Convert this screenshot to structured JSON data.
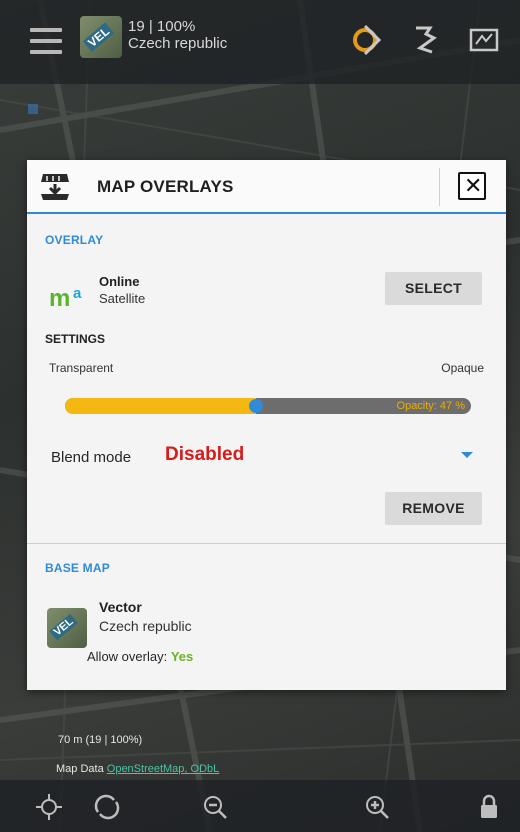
{
  "topbar": {
    "zoom_status": "19 | 100%",
    "region": "Czech republic",
    "icons": [
      "menu-icon",
      "map-icon",
      "gps-icon",
      "route-icon",
      "map-manager-icon"
    ]
  },
  "dialog": {
    "title": "MAP OVERLAYS",
    "overlay": {
      "section_label": "OVERLAY",
      "name": "Online",
      "type": "Satellite",
      "select_label": "SELECT"
    },
    "settings": {
      "section_label": "SETTINGS",
      "left_label": "Transparent",
      "right_label": "Opaque",
      "opacity_text": "Opacity: 47 %",
      "opacity": 0.47,
      "blend_label": "Blend mode",
      "blend_value": "Disabled",
      "remove_label": "REMOVE"
    },
    "base_map": {
      "section_label": "BASE MAP",
      "name": "Vector",
      "region": "Czech republic",
      "allow_label": "Allow overlay:",
      "allow_value": "Yes"
    }
  },
  "map": {
    "scale_text": "70 m (19 | 100%)",
    "map_data_label": "Map Data",
    "map_data_link": "OpenStreetMap, ODbL"
  },
  "colors": {
    "accent": "#2f8bd8",
    "slider_fill": "#f5b812",
    "blend_value": "#d81b1b",
    "allow_yes": "#6bb229"
  }
}
